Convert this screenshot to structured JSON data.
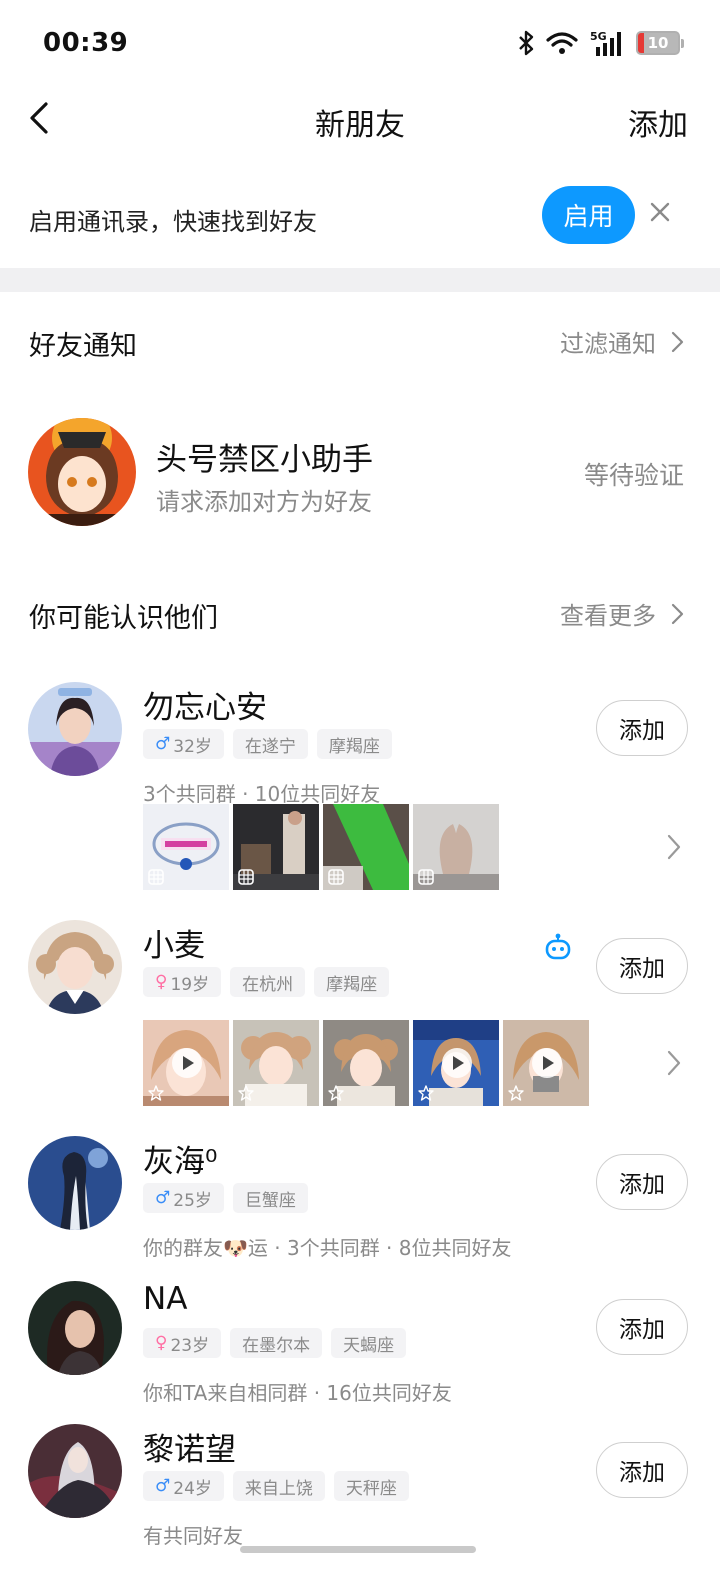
{
  "status_bar": {
    "time": "00:39",
    "network": "5G",
    "battery": "10"
  },
  "nav": {
    "title": "新朋友",
    "add_label": "添加"
  },
  "banner": {
    "text": "启用通讯录，快速找到好友",
    "enable_label": "启用"
  },
  "friend_notify": {
    "title": "好友通知",
    "filter_label": "过滤通知",
    "item": {
      "name": "头号禁区小助手",
      "sub": "请求添加对方为好友",
      "status": "等待验证"
    }
  },
  "suggest": {
    "title": "你可能认识他们",
    "more_label": "查看更多",
    "people": [
      {
        "name": "勿忘心安",
        "gender": "male",
        "age": "32岁",
        "tags": [
          "在遂宁",
          "摩羯座"
        ],
        "common": "3个共同群 · 10位共同好友",
        "add_label": "添加"
      },
      {
        "name": "小麦",
        "gender": "female",
        "age": "19岁",
        "tags": [
          "在杭州",
          "摩羯座"
        ],
        "common": "",
        "add_label": "添加"
      },
      {
        "name": "灰海⁰",
        "gender": "male",
        "age": "25岁",
        "tags": [
          "巨蟹座"
        ],
        "common": "你的群友🐶运 · 3个共同群 · 8位共同好友",
        "add_label": "添加"
      },
      {
        "name": "NA",
        "gender": "female",
        "age": "23岁",
        "tags": [
          "在墨尔本",
          "天蝎座"
        ],
        "common": "你和TA来自相同群 · 16位共同好友",
        "add_label": "添加"
      },
      {
        "name": "黎诺望",
        "gender": "male",
        "age": "24岁",
        "tags": [
          "来自上饶",
          "天秤座"
        ],
        "common": "有共同好友",
        "add_label": "添加"
      }
    ]
  },
  "colors": {
    "accent": "#0d99ff",
    "male": "#3a8df7",
    "female": "#ff6fa4",
    "muted": "#8a8a8a"
  }
}
